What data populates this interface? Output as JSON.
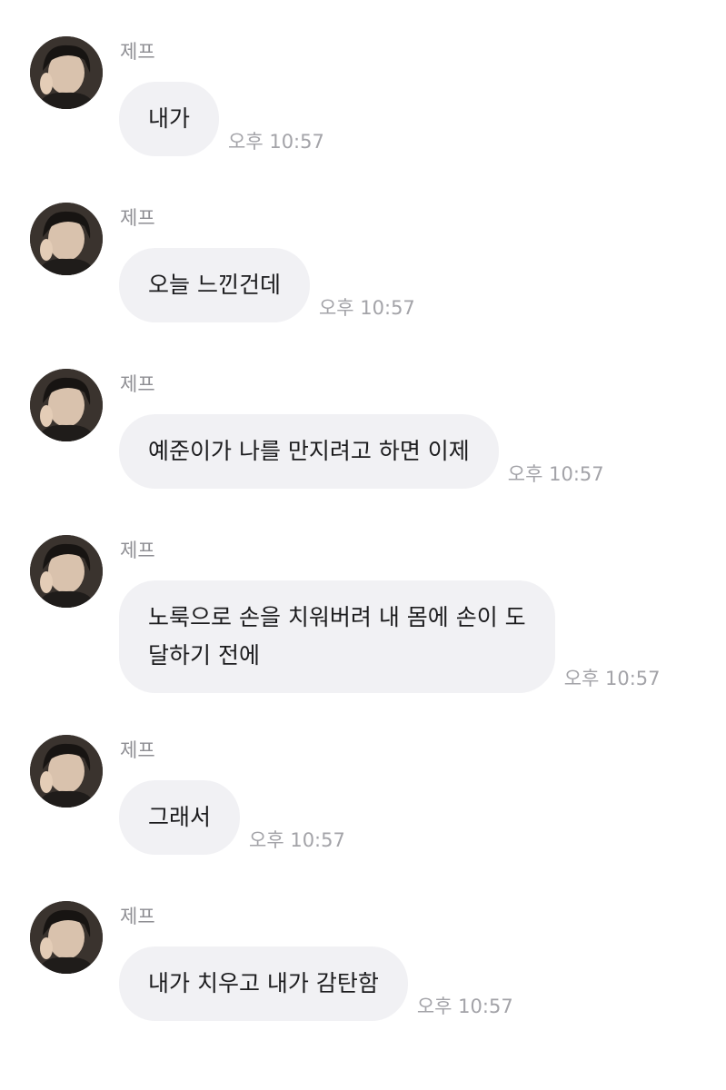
{
  "messages": [
    {
      "sender": "제프",
      "lines": [
        "내가"
      ],
      "time": "오후 10:57"
    },
    {
      "sender": "제프",
      "lines": [
        "오늘 느낀건데"
      ],
      "time": "오후 10:57"
    },
    {
      "sender": "제프",
      "lines": [
        "예준이가 나를 만지려고 하면 이제"
      ],
      "time": "오후 10:57"
    },
    {
      "sender": "제프",
      "lines": [
        "노룩으로 손을 치워버려 내 몸에 손이 도",
        "달하기 전에"
      ],
      "time": "오후 10:57"
    },
    {
      "sender": "제프",
      "lines": [
        "그래서"
      ],
      "time": "오후 10:57"
    },
    {
      "sender": "제프",
      "lines": [
        "내가 치우고 내가 감탄함"
      ],
      "time": "오후 10:57"
    }
  ],
  "colors": {
    "bubble": "#f1f1f4",
    "sender_text": "#8e8e93",
    "timestamp_text": "#a3a3a8",
    "message_text": "#1c1c1e"
  }
}
